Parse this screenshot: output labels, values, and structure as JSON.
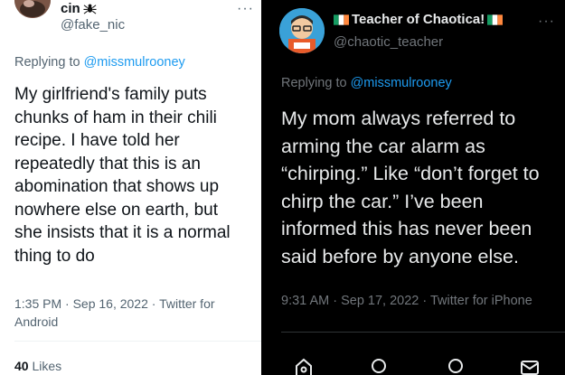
{
  "left_tweet": {
    "display_name": "cin",
    "name_emoji_icon": "spider-icon",
    "handle": "@fake_nic",
    "replying_to_prefix": "Replying to ",
    "replying_to_handle": "@missmulrooney",
    "text": "My girlfriend's family puts\nchunks of ham in their chili\nrecipe. I have told her\nrepeatedly that this is an\nabomination that shows up\nnowhere else on earth, but\nshe insists that it is a normal\nthing to do",
    "meta": "1:35 PM · Sep 16, 2022 · Twitter for\nAndroid",
    "likes_count": "40",
    "likes_label": " Likes",
    "more_glyph": "···"
  },
  "right_tweet": {
    "display_name": "Teacher of Chaotica!",
    "flag_icon": "irish-flag-icon",
    "flag_colors": [
      "#169b62",
      "#ffffff",
      "#ff883e"
    ],
    "handle": "@chaotic_teacher",
    "replying_to_prefix": "Replying to ",
    "replying_to_handle": "@missmulrooney",
    "text": "My mom always referred to\narming the car alarm as\n“chirping.” Like “don’t forget to\nchirp the car.” I’ve been\ninformed this has never been\nsaid before by anyone else.",
    "meta": "9:31 AM · Sep 17, 2022 · Twitter for iPhone",
    "more_glyph": "···",
    "action_icons": [
      "home-icon",
      "search-icon",
      "spaces-icon",
      "messages-icon"
    ]
  },
  "colors": {
    "link": "#1d9bf0",
    "light_bg": "#ffffff",
    "dark_bg": "#000000"
  }
}
